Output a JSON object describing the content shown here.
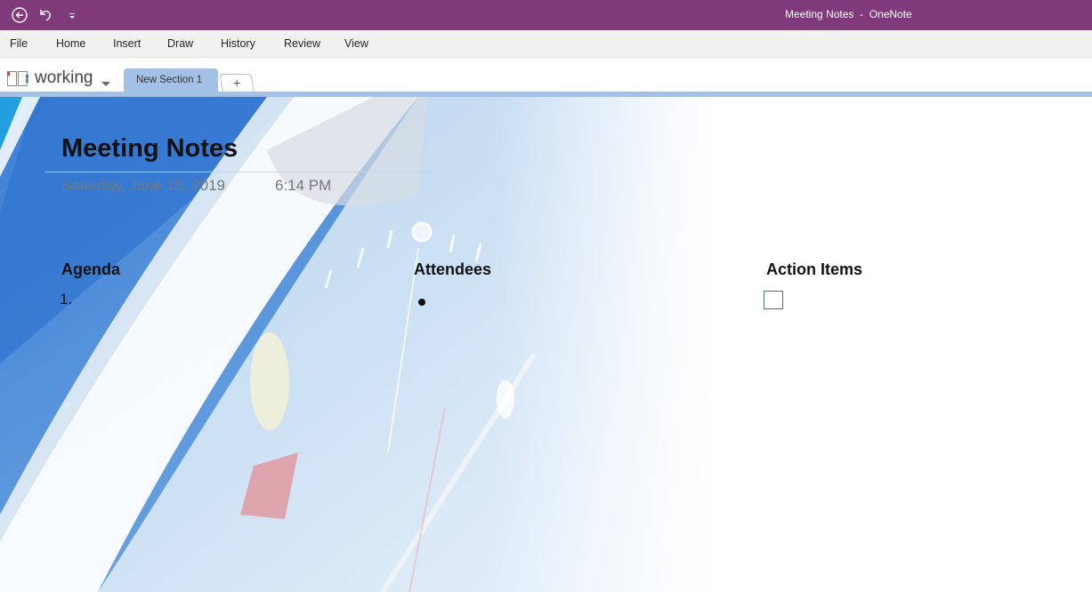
{
  "window": {
    "title": "Meeting Notes  -  OneNote",
    "accent_color": "#80397b"
  },
  "quick_access": {
    "back_icon": "back-circle-arrow-icon",
    "undo_icon": "undo-icon",
    "customize_icon": "customize-quick-access-icon"
  },
  "menu": {
    "items": [
      {
        "label": "File"
      },
      {
        "label": "Home"
      },
      {
        "label": "Insert"
      },
      {
        "label": "Draw"
      },
      {
        "label": "History"
      },
      {
        "label": "Review"
      },
      {
        "label": "View"
      }
    ]
  },
  "notebook": {
    "name": "working",
    "icon": "notebook-icon",
    "sections": [
      {
        "label": "New Section 1",
        "active": true
      }
    ],
    "add_section_label": "+",
    "section_color": "#a3c1e6"
  },
  "page": {
    "title": "Meeting Notes",
    "date": "Saturday, June 15, 2019",
    "time": "6:14 PM",
    "columns": {
      "agenda": {
        "heading": "Agenda",
        "first_item_marker": "1."
      },
      "attendees": {
        "heading": "Attendees",
        "first_item_marker": "bullet"
      },
      "action_items": {
        "heading": "Action Items",
        "first_item_marker": "to-do checkbox",
        "checked": false
      }
    }
  }
}
